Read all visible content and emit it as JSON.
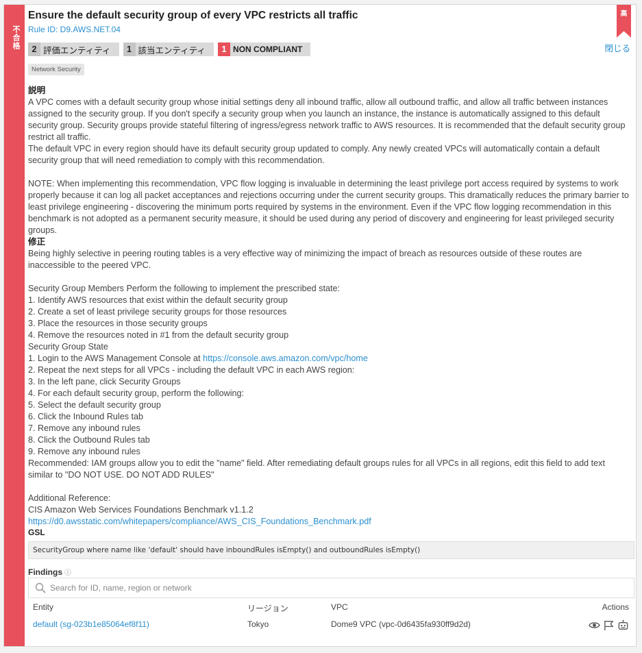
{
  "sidebar": {
    "status_label": "不合格"
  },
  "header": {
    "title": "Ensure the default security group of every VPC restricts all traffic",
    "rule_id": "Rule ID: D9.AWS.NET.04",
    "severity": "高",
    "close_label": "閉じる"
  },
  "badges": [
    {
      "count": "2",
      "label": "評価エンティティ"
    },
    {
      "count": "1",
      "label": "該当エンティティ"
    },
    {
      "count": "1",
      "label": "NON COMPLIANT"
    }
  ],
  "tag": "Network Security",
  "description": {
    "heading": "説明",
    "p1": "A VPC comes with a default security group whose initial settings deny all inbound traffic, allow all outbound traffic, and allow all traffic between instances assigned to the security group. If you don't specify a security group when you launch an instance, the instance is automatically assigned to this default security group. Security groups provide stateful filtering of ingress/egress network traffic to AWS resources. It is recommended that the default security group restrict all traffic.",
    "p2": "The default VPC in every region should have its default security group updated to comply. Any newly created VPCs will automatically contain a default security group that will need remediation to comply with this recommendation.",
    "p3": "NOTE: When implementing this recommendation, VPC flow logging is invaluable in determining the least privilege port access required by systems to work properly because it can log all packet acceptances and rejections occurring under the current security groups. This dramatically reduces the primary barrier to least privilege engineering - discovering the minimum ports required by systems in the environment. Even if the VPC flow logging recommendation in this benchmark is not adopted as a permanent security measure, it should be used during any period of discovery and engineering for least privileged security groups."
  },
  "remediation": {
    "heading": "修正",
    "p1": "Being highly selective in peering routing tables is a very effective way of minimizing the impact of breach as resources outside of these routes are inaccessible to the peered VPC.",
    "members_intro": "Security Group Members Perform the following to implement the prescribed state:",
    "members_steps": [
      "1. Identify AWS resources that exist within the default security group",
      "2. Create a set of least privilege security groups for those resources",
      "3. Place the resources in those security groups",
      "4. Remove the resources noted in #1 from the default security group"
    ],
    "state_heading": "Security Group State",
    "console_prefix": "1. Login to the AWS Management Console at ",
    "console_link": "https://console.aws.amazon.com/vpc/home",
    "state_steps": [
      "2. Repeat the next steps for all VPCs - including the default VPC in each AWS region:",
      "3. In the left pane, click Security Groups",
      "4. For each default security group, perform the following:",
      "5. Select the default security group",
      "6. Click the Inbound Rules tab",
      "7. Remove any inbound rules",
      "8. Click the Outbound Rules tab",
      "9. Remove any inbound rules"
    ],
    "recommended": "Recommended: IAM groups allow you to edit the \"name\" field. After remediating default groups rules for all VPCs in all regions, edit this field to add text similar to \"DO NOT USE. DO NOT ADD RULES\"",
    "ref_heading": "Additional Reference:",
    "ref_title": "CIS Amazon Web Services Foundations Benchmark v1.1.2",
    "ref_link": "https://d0.awsstatic.com/whitepapers/compliance/AWS_CIS_Foundations_Benchmark.pdf"
  },
  "gsl": {
    "heading": "GSL",
    "code": "SecurityGroup where name like 'default' should have inboundRules isEmpty() and outboundRules isEmpty()"
  },
  "findings": {
    "heading": "Findings",
    "info_icon": "ⓘ",
    "search_placeholder": "Search for ID, name, region or network",
    "columns": {
      "entity": "Entity",
      "region": "リージョン",
      "vpc": "VPC",
      "actions": "Actions"
    },
    "rows": [
      {
        "entity": "default (sg-023b1e85064ef8f11)",
        "region": "Tokyo",
        "vpc": "Dome9 VPC (vpc-0d6435fa930ff9d2d)"
      }
    ]
  },
  "icons": {
    "view": "eye-icon",
    "exclude": "flag-icon",
    "remediate": "bot-icon",
    "search": "search-icon",
    "info": "info-icon"
  },
  "colors": {
    "fail_red": "#e8505b",
    "link_blue": "#2b8fcf"
  }
}
